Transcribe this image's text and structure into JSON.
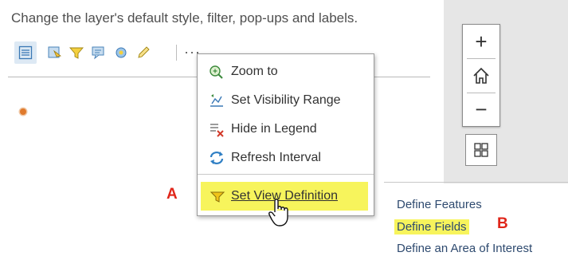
{
  "description": "Change the layer's default style, filter, pop-ups and labels.",
  "toolbar": {
    "icons": [
      "list-settings-icon",
      "style-icon",
      "filter-icon",
      "popup-icon",
      "labels-icon",
      "edit-icon"
    ],
    "more_label": "···"
  },
  "map_controls": {
    "zoom_in_label": "+",
    "zoom_out_label": "−"
  },
  "menu": {
    "items": [
      {
        "label": "Zoom to",
        "icon": "zoom-icon"
      },
      {
        "label": "Set Visibility Range",
        "icon": "visibility-range-icon"
      },
      {
        "label": "Hide in Legend",
        "icon": "hide-legend-icon"
      },
      {
        "label": "Refresh Interval",
        "icon": "refresh-icon"
      },
      {
        "label": "Set View Definition",
        "icon": "view-definition-icon"
      }
    ]
  },
  "submenu": {
    "items": [
      {
        "label": "Define Features"
      },
      {
        "label": "Define Fields"
      },
      {
        "label": "Define an Area of Interest"
      }
    ]
  },
  "annotations": {
    "a": "A",
    "b": "B"
  },
  "colors": {
    "highlight": "#f7f45c",
    "annotation": "#e0261a",
    "submenu_text": "#2e4a6f",
    "map_bg": "#e6e6e6"
  }
}
